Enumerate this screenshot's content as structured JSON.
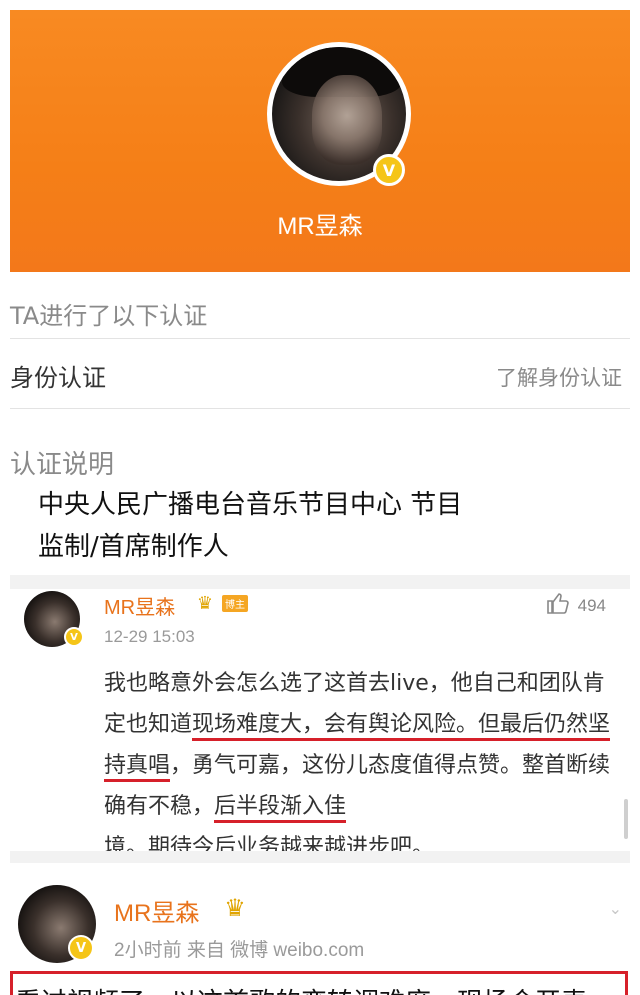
{
  "profile": {
    "name": "MR昱森",
    "verify_icon": "verified-v-icon"
  },
  "verification": {
    "section_title": "TA进行了以下认证",
    "identity_label": "身份认证",
    "identity_link": "了解身份认证",
    "desc_title": "认证说明",
    "desc_line1": "中央人民广播电台音乐节目中心 节目",
    "desc_line2": "监制/首席制作人"
  },
  "comment1": {
    "name": "MR昱森",
    "badge": "博主",
    "time": "12-29 15:03",
    "likes": "494",
    "seg1": "我也略意外会怎么选了这首去live，他自己和团队肯定也知道",
    "seg2": "现场难度大，会有舆论风险。",
    "seg3": "但最后仍然坚持真唱",
    "seg4": "，勇气可嘉，这份儿态度值得点赞。整首断续确有不稳，",
    "seg5": "后半段渐入佳",
    "seg6": "境",
    "seg7": "。期待今后业务越来越进步吧。"
  },
  "comment2": {
    "name": "MR昱森",
    "meta": "2小时前  来自 微博 weibo.com",
    "body_fragment": "看过视频了，以这首歌的变转调难度，现场会开麦"
  },
  "colors": {
    "header": "#f57f17",
    "name_orange": "#e8731c",
    "verify_gold": "#f5c518",
    "underline_red": "#d6202a"
  }
}
